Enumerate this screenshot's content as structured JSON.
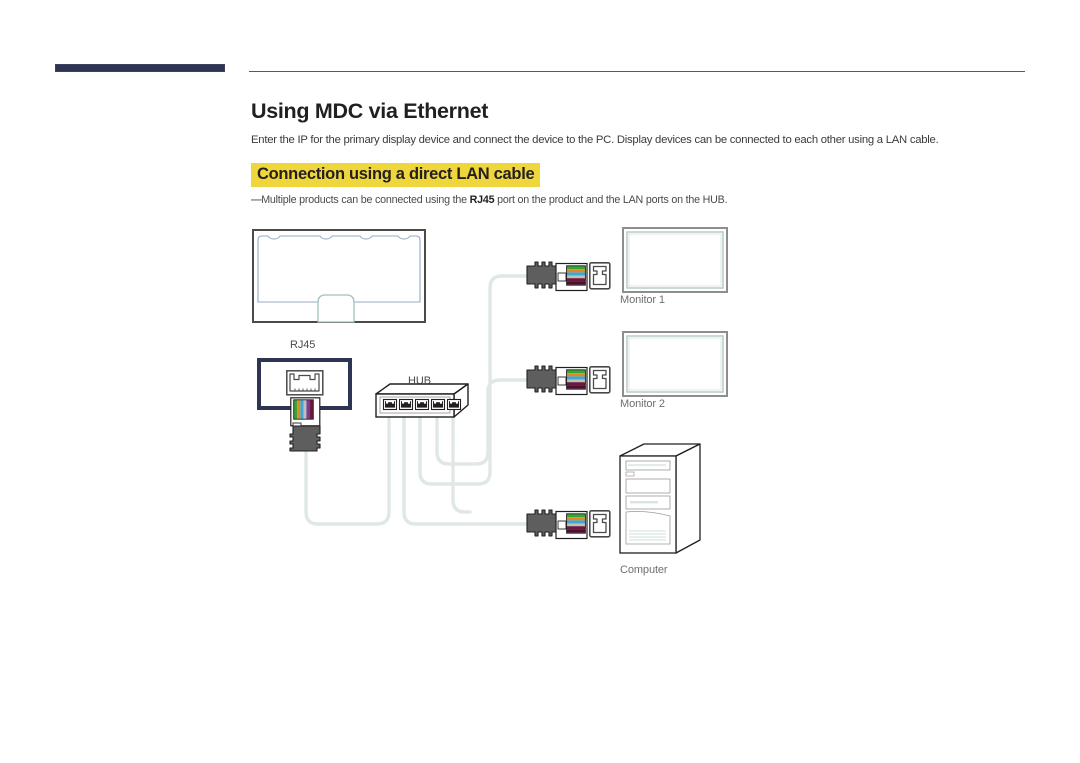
{
  "document": {
    "heading": "Using MDC via Ethernet",
    "intro": "Enter the IP for the primary display device and connect the device to the PC. Display devices can be connected to each other using a LAN cable.",
    "subheading": "Connection using a direct LAN cable",
    "note": {
      "dash": "—",
      "text_before": "Multiple products can be connected using the ",
      "emphasis": "RJ45",
      "text_after": " port on the product and the LAN ports on the HUB."
    }
  },
  "diagram": {
    "labels": {
      "rj45": "RJ45",
      "hub": "HUB",
      "monitor1": "Monitor 1",
      "monitor2": "Monitor 2",
      "computer": "Computer"
    },
    "colors": {
      "highlight_yellow": "#efd63c",
      "navy": "#2e3553",
      "cable": "#dfe8e6",
      "connector_body": "#5e5e5e",
      "outline": "#231f20",
      "label_grey": "#6f6f6f",
      "wire_green": "#3ba23b",
      "wire_orange": "#e08a1e",
      "wire_blue": "#3aa8d8",
      "wire_maroon": "#6b1b3a",
      "wire_purple": "#7a3d8f"
    },
    "hub_port_count": 5,
    "connector_count": 3
  }
}
